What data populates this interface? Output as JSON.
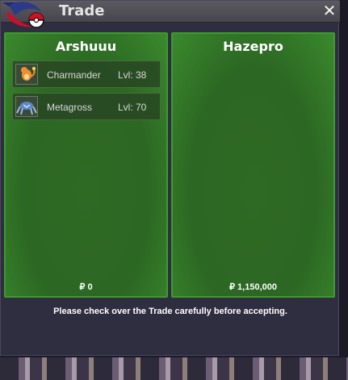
{
  "window": {
    "title": "Trade",
    "close_icon": "close-icon"
  },
  "left_player": {
    "name": "Arshuuu",
    "items": [
      {
        "pokemon": "Charmander",
        "level": "Lvl: 38",
        "icon": "charmander-sprite-icon"
      },
      {
        "pokemon": "Metagross",
        "level": "Lvl: 70",
        "icon": "metagross-sprite-icon"
      }
    ],
    "money": "₽ 0"
  },
  "right_player": {
    "name": "Hazepro",
    "items": [],
    "money": "₽ 1,150,000"
  },
  "notice": "Please check over the Trade carefully before accepting.",
  "colors": {
    "panel_green": "#2c6723",
    "panel_border": "#3e9a2f",
    "window_bg": "#2f2d40",
    "titlebar": "#505056"
  }
}
